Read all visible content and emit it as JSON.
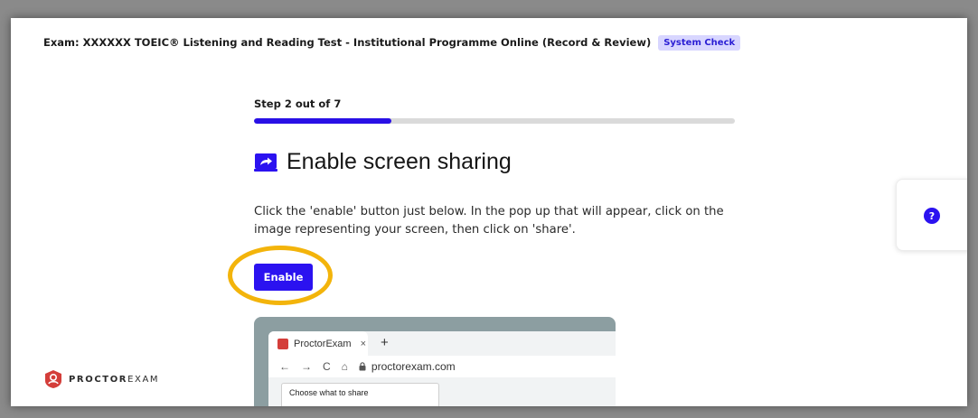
{
  "header": {
    "exam_title": "Exam: XXXXXX TOEIC® Listening and Reading Test - Institutional Programme Online (Record & Review)",
    "badge": "System Check"
  },
  "step": {
    "label": "Step 2 out of 7",
    "progress_fraction": 0.2857
  },
  "main": {
    "title": "Enable screen sharing",
    "title_icon": "screen-share-icon",
    "instructions": "Click the 'enable' button just below. In the pop up that will appear, click on the image representing your screen, then click on 'share'.",
    "enable_label": "Enable"
  },
  "help": {
    "icon": "help-icon",
    "glyph": "?"
  },
  "illustration": {
    "tab_title": "ProctorExam",
    "tab_close": "×",
    "new_tab": "+",
    "nav_back": "←",
    "nav_forward": "→",
    "nav_reload": "C",
    "nav_home": "⌂",
    "url": "proctorexam.com",
    "dialog_title": "Choose what to share"
  },
  "brand": {
    "name_bold": "PROCTOR",
    "name_light": "EXAM"
  },
  "colors": {
    "accent": "#2b12f0",
    "badge_bg": "#d8d6ff",
    "highlight_ring": "#f3b40b",
    "brand_red": "#d43e3a"
  }
}
